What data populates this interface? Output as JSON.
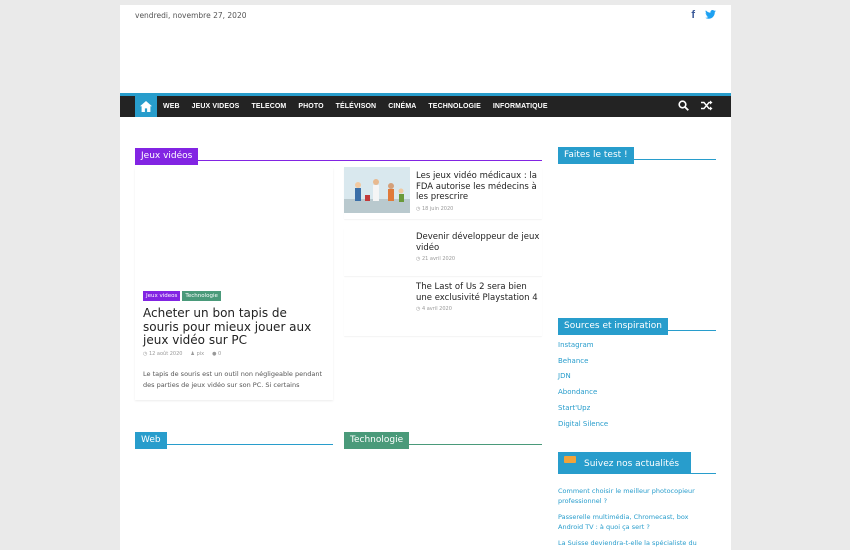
{
  "header": {
    "date": "vendredi, novembre 27, 2020"
  },
  "nav": {
    "items": [
      "WEB",
      "JEUX VIDEOS",
      "TELECOM",
      "PHOTO",
      "TÉLÉVISON",
      "CINÉMA",
      "TECHNOLOGIE",
      "INFORMATIQUE"
    ]
  },
  "sections": {
    "jeux": "Jeux vidéos",
    "web": "Web",
    "technologie": "Technologie"
  },
  "featured": {
    "tags": [
      "Jeux videos",
      "Technologie"
    ],
    "title": "Acheter un bon tapis de souris pour mieux jouer aux jeux vidéo sur PC",
    "date": "12 août 2020",
    "author": "pix",
    "comments": "0",
    "excerpt": "Le tapis de souris est un outil non négligeable pendant des parties de jeux vidéo sur son PC. Si certains"
  },
  "posts": [
    {
      "title": "Les jeux vidéo médicaux : la FDA autorise les médecins à les prescrire",
      "date": "18 juin 2020"
    },
    {
      "title": "Devenir développeur de jeux vidéo",
      "date": "21 avril 2020"
    },
    {
      "title": "The Last of Us 2 sera bien une exclusivité Playstation 4",
      "date": "4 avril 2020"
    }
  ],
  "sidebar": {
    "test_title": "Faites le test !",
    "sources_title": "Sources et inspiration",
    "sources": [
      "Instagram",
      "Behance",
      "JDN",
      "Abondance",
      "Start'Upz",
      "Digital Silence"
    ],
    "rss_title": "Suivez nos actualités",
    "rss": [
      "Comment choisir le meilleur photocopieur professionnel ?",
      "Passerelle multimédia, Chromecast, box Android TV : à quoi ça sert ?",
      "La Suisse deviendra-t-elle la spécialiste du"
    ]
  },
  "colors": {
    "accent": "#289dcc",
    "jeux": "#8224e3",
    "tag_jeux": "#8224e3",
    "tag_tech": "#4a9a7a",
    "tech": "#4a9a7a"
  }
}
